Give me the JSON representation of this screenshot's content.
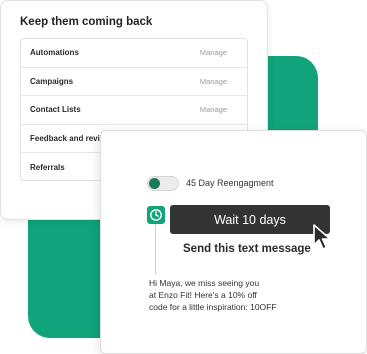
{
  "back_card": {
    "title": "Keep them coming back",
    "rows": [
      {
        "label": "Automations",
        "action": "Manage"
      },
      {
        "label": "Campaigns",
        "action": "Manage"
      },
      {
        "label": "Contact Lists",
        "action": "Manage"
      },
      {
        "label": "Feedback and review",
        "action": ""
      },
      {
        "label": "Referrals",
        "action": ""
      }
    ]
  },
  "front_card": {
    "toggle_label": "45 Day Reengagment",
    "toggle_on": true,
    "wait_button_label": "Wait 10 days",
    "send_heading": "Send this text message",
    "message_lines": [
      "Hi Maya, we miss seeing you",
      "at  Enzo Fit! Here's a 10% off",
      "code  for a little inspiration: 10OFF"
    ]
  },
  "colors": {
    "accent": "#11a37a",
    "button": "#333333",
    "knob": "#1c7a5c"
  },
  "icons": [
    "clock-icon",
    "cursor-arrow-icon"
  ]
}
